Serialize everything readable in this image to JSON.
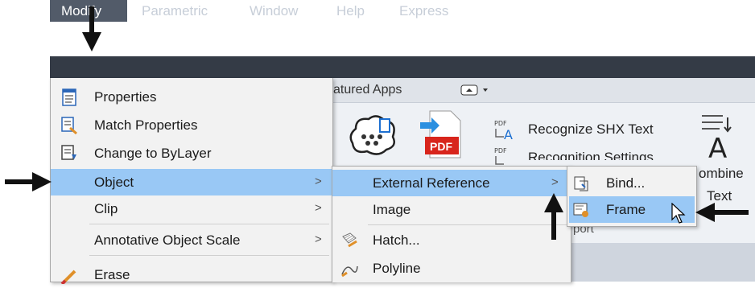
{
  "menubar": {
    "items": [
      "Modify",
      "Parametric",
      "Window",
      "Help",
      "Express"
    ]
  },
  "ribbon": {
    "tab_label": "atured Apps",
    "recognize_shx": "Recognize SHX Text",
    "recognition_settings": "Recognition Settings",
    "combine_line1": "ombine",
    "combine_line2": "Text",
    "pdf_label": "PDF",
    "import_label": "port"
  },
  "modify_menu": {
    "items": [
      {
        "label": "Properties",
        "icon": "properties-icon"
      },
      {
        "label": "Match Properties",
        "icon": "match-properties-icon"
      },
      {
        "label": "Change to ByLayer",
        "icon": "change-bylayer-icon"
      },
      {
        "label": "Object",
        "arrow": ">"
      },
      {
        "label": "Clip",
        "arrow": ">"
      },
      {
        "label": "Annotative Object Scale",
        "arrow": ">"
      },
      {
        "label": "Erase",
        "icon": "eraser-icon"
      }
    ]
  },
  "object_menu": {
    "items": [
      {
        "label": "External Reference",
        "arrow": ">"
      },
      {
        "label": "Image",
        "arrow": ">"
      },
      {
        "label": "Hatch...",
        "icon": "hatch-icon"
      },
      {
        "label": "Polyline",
        "icon": "polyline-icon"
      }
    ]
  },
  "xref_menu": {
    "items": [
      {
        "label": "Bind...",
        "icon": "bind-icon"
      },
      {
        "label": "Frame",
        "icon": "frame-icon"
      }
    ]
  },
  "colors": {
    "menubar_bg": "#343b46",
    "highlight": "#99c8f5",
    "arrow": "#111111"
  }
}
